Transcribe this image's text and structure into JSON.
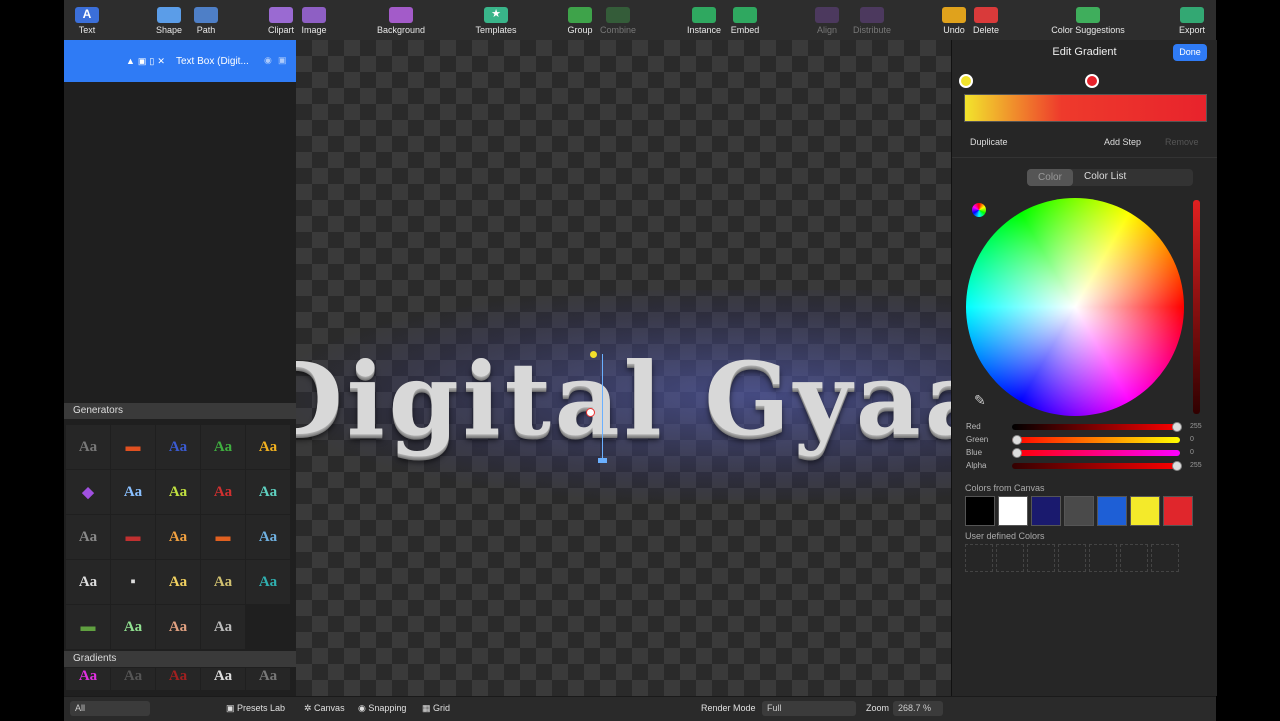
{
  "toolbar": {
    "text": "Text",
    "shape": "Shape",
    "path": "Path",
    "clipart": "Clipart",
    "image": "Image",
    "background": "Background",
    "templates": "Templates",
    "group": "Group",
    "combine": "Combine",
    "instance": "Instance",
    "embed": "Embed",
    "align": "Align",
    "distribute": "Distribute",
    "undo": "Undo",
    "delete": "Delete",
    "color_suggestions": "Color Suggestions",
    "export": "Export"
  },
  "layers": {
    "selected_label": "Text Box (Digit..."
  },
  "sidebar": {
    "generators_title": "Generators",
    "gradients_title": "Gradients",
    "generator_items": [
      "Aa",
      "▬",
      "Aa",
      "Aa",
      "Aa",
      "◆",
      "Aa",
      "Aa",
      "Aa",
      "Aa",
      "Aa",
      "▬",
      "Aa",
      "▬",
      "Aa",
      "Aa",
      "▪",
      "Aa",
      "Aa",
      "Aa",
      "▬",
      "Aa",
      "Aa",
      "Aa"
    ],
    "gradient_items": [
      "Aa",
      "Aa",
      "Aa",
      "Aa",
      "Aa"
    ]
  },
  "bottom": {
    "filter_select": "All",
    "presets_lab": "Presets Lab",
    "canvas": "Canvas",
    "snapping": "Snapping",
    "grid": "Grid",
    "render_mode_label": "Render Mode",
    "render_mode_value": "Full",
    "zoom_label": "Zoom",
    "zoom_value": "268.7 %"
  },
  "canvas": {
    "text": "Digital Gyaan"
  },
  "gradient_panel": {
    "title": "Edit Gradient",
    "done": "Done",
    "duplicate": "Duplicate",
    "add_step": "Add Step",
    "remove": "Remove",
    "tab_color": "Color",
    "tab_color_list": "Color List",
    "sliders": [
      {
        "label": "Red",
        "value": "255"
      },
      {
        "label": "Green",
        "value": "0"
      },
      {
        "label": "Blue",
        "value": "0"
      },
      {
        "label": "Alpha",
        "value": "255"
      }
    ],
    "colors_from_canvas_title": "Colors from Canvas",
    "user_defined_title": "User defined Colors",
    "canvas_colors": [
      "#000000",
      "#ffffff",
      "#1a1a6e",
      "#4a4a4a",
      "#1e5fd6",
      "#f4ea2a",
      "#e0262c"
    ],
    "stop_colors": [
      "#f2e42c",
      "#e8232c"
    ]
  }
}
